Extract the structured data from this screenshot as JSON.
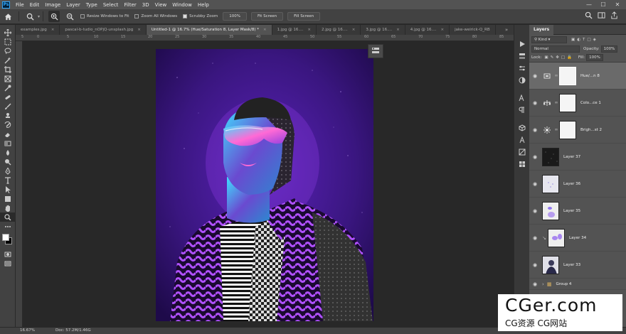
{
  "menu": {
    "logo": "Ps",
    "items": [
      "File",
      "Edit",
      "Image",
      "Layer",
      "Type",
      "Select",
      "Filter",
      "3D",
      "View",
      "Window",
      "Help"
    ],
    "window_controls": [
      "—",
      "☐",
      "✕"
    ]
  },
  "options": {
    "resize_windows": "Resize Windows to Fit",
    "zoom_all": "Zoom All Windows",
    "scrubby_zoom": "Scrubby Zoom",
    "zoom_value": "100%",
    "fit_screen": "Fit Screen",
    "fill_screen": "Fill Screen"
  },
  "tabs": [
    {
      "label": "examples.jpg",
      "active": false
    },
    {
      "label": "pascal-b-tudio_nOPjQ-unsplash.jpg",
      "active": false
    },
    {
      "label": "Untitled-1 @ 16.7% (Hue/Saturation 8, Layer Mask/8) *",
      "active": true
    },
    {
      "label": "1.jpg @ 16....",
      "active": false
    },
    {
      "label": "2.jpg @ 16....",
      "active": false
    },
    {
      "label": "3.jpg @ 16....",
      "active": false
    },
    {
      "label": "4.jpg @ 16....",
      "active": false
    },
    {
      "label": "jake-weirick-Q_RB",
      "active": false
    }
  ],
  "tab_overflow": "»",
  "ruler": {
    "h_labels": [
      "5",
      "0",
      "5",
      "10",
      "15",
      "20",
      "25",
      "30",
      "35",
      "40",
      "45",
      "50",
      "55",
      "60",
      "65",
      "70",
      "75",
      "80",
      "85",
      "90"
    ]
  },
  "status": {
    "zoom": "16.67%",
    "doc": "Doc: 57.2M/1.46G"
  },
  "layers_panel": {
    "title": "Layers",
    "filter_kind": "Kind",
    "blend_mode": "Normal",
    "opacity_label": "Opacity:",
    "opacity_value": "100%",
    "lock_label": "Lock:",
    "fill_label": "Fill:",
    "fill_value": "100%",
    "layers": [
      {
        "name": "Hue/...n 8",
        "type": "hue",
        "selected": true
      },
      {
        "name": "Colo...ce 1",
        "type": "balance",
        "selected": false
      },
      {
        "name": "Brigh...st 2",
        "type": "brightness",
        "selected": false
      },
      {
        "name": "Layer 37",
        "type": "noise",
        "selected": false
      },
      {
        "name": "Layer 36",
        "type": "light",
        "selected": false
      },
      {
        "name": "Layer 35",
        "type": "blobs",
        "selected": false
      },
      {
        "name": "Layer 34",
        "type": "blobs2",
        "selected": false
      },
      {
        "name": "Layer 33",
        "type": "photo",
        "selected": false
      },
      {
        "name": "Group 4",
        "type": "group",
        "selected": false
      }
    ]
  },
  "watermark": {
    "title": "CGer.com",
    "subtitle": "CG资源 CG网站"
  },
  "colors": {
    "canvas_bg": "#3a1680",
    "accent_purple": "#8a3ae0",
    "cyan": "#3ee0ff"
  }
}
